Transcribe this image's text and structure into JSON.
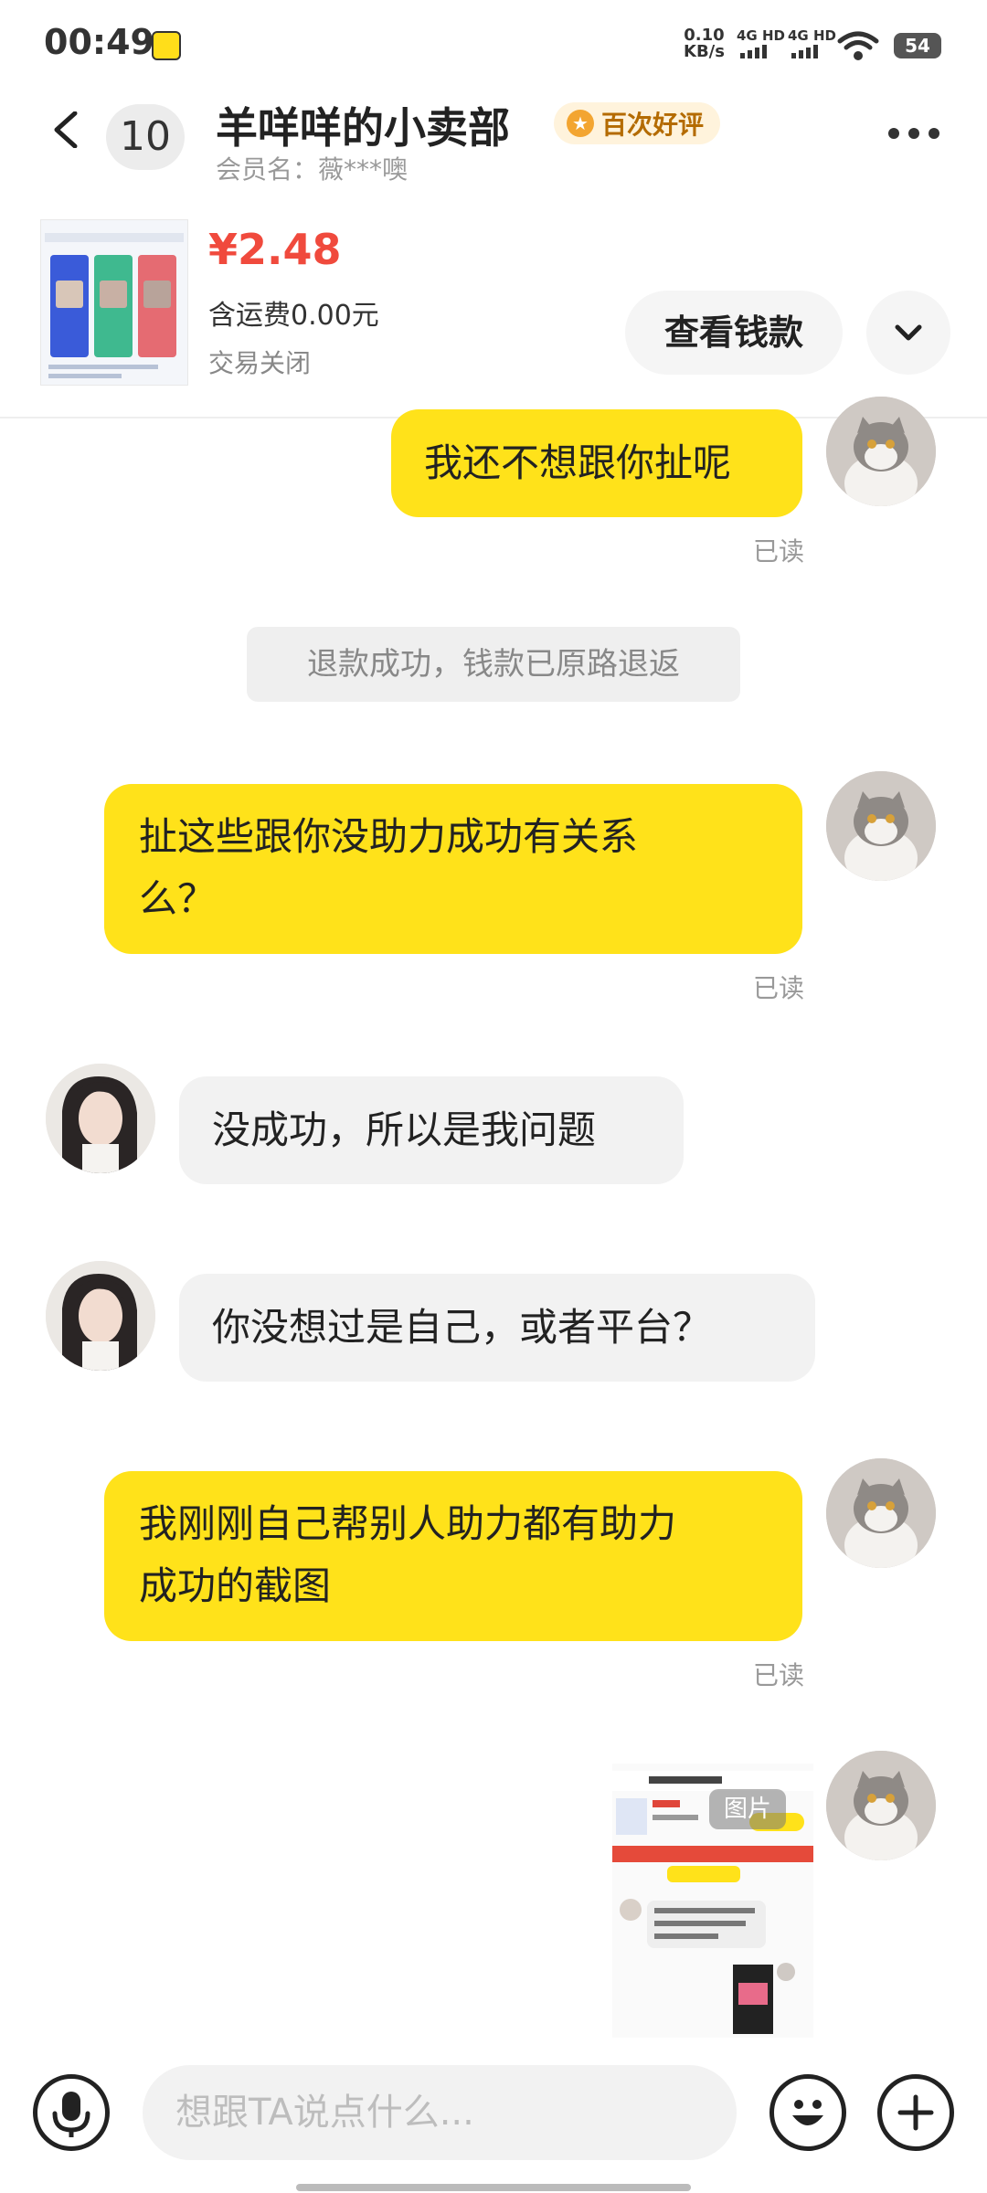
{
  "status_bar": {
    "time": "00:49",
    "net_speed_value": "0.10",
    "net_speed_unit": "KB/s",
    "signal1": "4G HD",
    "signal2": "4G HD",
    "battery": "54"
  },
  "header": {
    "unread_count": "10",
    "shop_name": "羊咩咩的小卖部",
    "praise_badge": "百次好评",
    "member_name": "会员名：薇***噢"
  },
  "product": {
    "price": "¥2.48",
    "shipping": "含运费0.00元",
    "status": "交易关闭",
    "view_button": "查看钱款"
  },
  "messages": {
    "m1": "我还不想跟你扯呢",
    "m1_read": "已读",
    "system": "退款成功，钱款已原路退返",
    "m2_line1": "扯这些跟你没助力成功有关系",
    "m2_line2": "么？",
    "m2_read": "已读",
    "m3": "没成功，所以是我问题",
    "m4": "你没想过是自己，或者平台？",
    "m5_line1": "我刚刚自己帮别人助力都有助力",
    "m5_line2": "成功的截图",
    "m5_read": "已读",
    "image_tag": "图片"
  },
  "input_bar": {
    "placeholder": "想跟TA说点什么..."
  },
  "colors": {
    "accent_yellow": "#ffe21a",
    "price_red": "#f04a3d"
  }
}
